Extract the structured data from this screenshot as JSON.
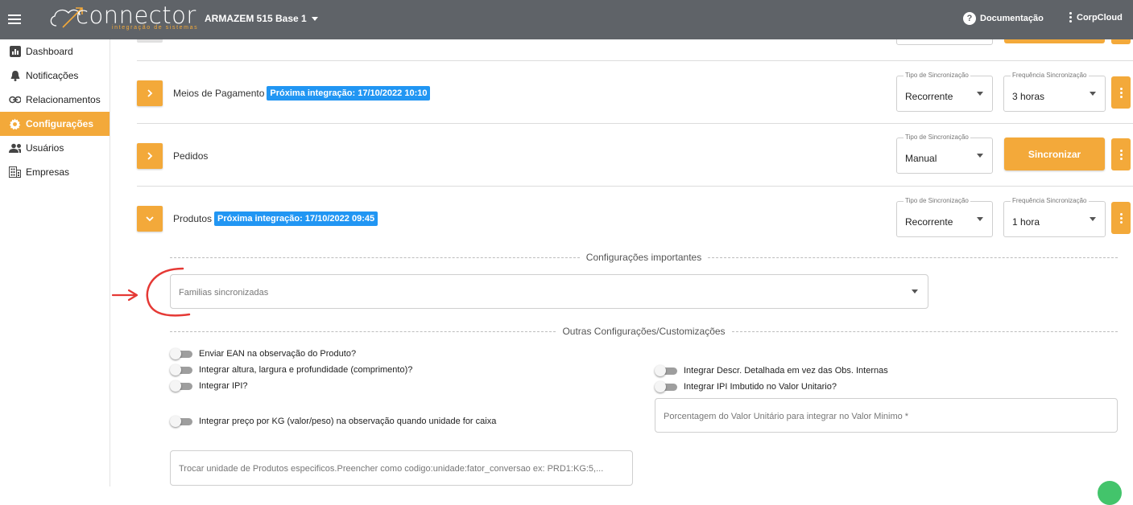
{
  "header": {
    "logo_text": "connector",
    "logo_sub": "integração de sistemas",
    "company": "ARMAZEM 515 Base 1",
    "docs": "Documentação",
    "account": "CorpCloud"
  },
  "sidebar": {
    "items": [
      {
        "label": "Dashboard",
        "icon": "dashboard-icon"
      },
      {
        "label": "Notificações",
        "icon": "bell-icon"
      },
      {
        "label": "Relacionamentos",
        "icon": "link-icon"
      },
      {
        "label": "Configurações",
        "icon": "gear-icon",
        "active": true
      },
      {
        "label": "Usuários",
        "icon": "users-icon"
      },
      {
        "label": "Empresas",
        "icon": "building-icon"
      }
    ]
  },
  "rows": {
    "pagamento": {
      "title": "Meios de Pagamento",
      "badge": "Próxima integração: 17/10/2022 10:10",
      "sync_type_label": "Tipo de Sincronização",
      "sync_type": "Recorrente",
      "freq_label": "Frequência Sincronização",
      "freq": "3 horas"
    },
    "pedidos": {
      "title": "Pedidos",
      "sync_type_label": "Tipo de Sincronização",
      "sync_type": "Manual",
      "sync_button": "Sincronizar"
    },
    "produtos": {
      "title": "Produtos",
      "badge": "Próxima integração: 17/10/2022 09:45",
      "sync_type_label": "Tipo de Sincronização",
      "sync_type": "Recorrente",
      "freq_label": "Frequência Sincronização",
      "freq": "1 hora"
    }
  },
  "produtos_config": {
    "section1": "Configurações importantes",
    "familias_placeholder": "Familias sincronizadas",
    "section2": "Outras Configurações/Customizações",
    "toggles_left": [
      "Enviar EAN na observação do Produto?",
      "Integrar altura, largura e profundidade (comprimento)?",
      "Integrar IPI?",
      "Integrar preço por KG (valor/peso) na observação quando unidade for caixa"
    ],
    "toggles_right": [
      "Integrar Descr. Detalhada em vez das Obs. Internas",
      "Integrar IPI Imbutido no Valor Unitario?"
    ],
    "porcentagem_placeholder": "Porcentagem do Valor Unitário para integrar no Valor Minimo *",
    "trocar_placeholder": "Trocar unidade de Produtos especificos.Preencher como codigo:unidade:fator_conversao ex: PRD1:KG:5,..."
  },
  "colors": {
    "accent": "#f3a93a",
    "topbar": "#5f6368",
    "badge": "#2196f3",
    "annotation": "#e53935"
  }
}
